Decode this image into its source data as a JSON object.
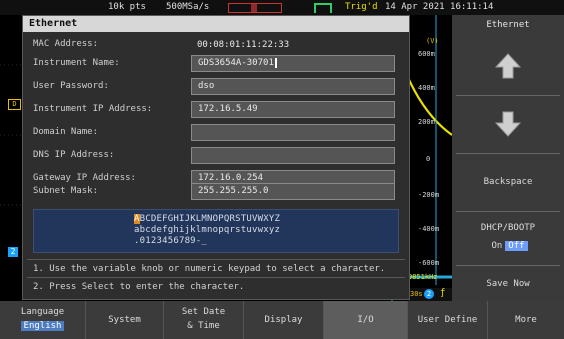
{
  "topbar": {
    "points": "10k pts",
    "sample_rate": "500MSa/s",
    "trigger_state": "Trig'd",
    "date_time": "14 Apr 2021 16:11:14"
  },
  "scale": {
    "unit": "(V)",
    "ticks": [
      "600m",
      "400m",
      "200m",
      "0",
      "-200m",
      "-400m",
      "-600m"
    ],
    "freq": "9851kHz",
    "timebase_fragment": "30s"
  },
  "markers": {
    "ref_d": "D",
    "ch2": "2"
  },
  "dialog": {
    "title": "Ethernet",
    "fields": [
      {
        "label": "MAC Address:",
        "value": "00:08:01:11:22:33",
        "editable": false
      },
      {
        "label": "Instrument Name:",
        "value": "GDS3654A-30701",
        "editable": true
      },
      {
        "label": "User Password:",
        "value": "dso",
        "editable": true
      },
      {
        "label": "Instrument IP Address:",
        "value": "172.16.5.49",
        "editable": true
      },
      {
        "label": "Domain Name:",
        "value": "",
        "editable": true
      },
      {
        "label": "DNS IP Address:",
        "value": "",
        "editable": true
      },
      {
        "label": "Gateway IP Address:",
        "value": "172.16.0.254",
        "editable": true
      },
      {
        "label": "Subnet Mask:",
        "value": "255.255.255.0",
        "editable": true
      }
    ],
    "charset": {
      "highlight_char": "A",
      "line1_rest": "BCDEFGHIJKLMNOPQRSTUVWXYZ",
      "line2": "abcdefghijklmnopqrstuvwxyz",
      "line3": ".0123456789-_"
    },
    "instructions": [
      "1. Use the variable knob or numeric keypad to select a character.",
      "2. Press Select to enter the character."
    ]
  },
  "side_menu": {
    "title": "Ethernet",
    "backspace": "Backspace",
    "dhcp_label": "DHCP/BOOTP",
    "dhcp_on": "On",
    "dhcp_off": "Off",
    "save_now": "Save Now"
  },
  "bottom_menu": {
    "language_label": "Language",
    "language_value": "English",
    "system": "System",
    "set_date_1": "Set Date",
    "set_date_2": "& Time",
    "display": "Display",
    "io": "I/O",
    "user_define": "User Define",
    "more": "More"
  },
  "colors": {
    "trace": "#e8e000",
    "ch2_marker": "#1aa0ff",
    "trigger_green": "#33cc66",
    "highlight_orange": "#e08a1e",
    "active_off": "#6d9cff"
  },
  "icons": [
    "up-arrow-icon",
    "down-arrow-icon",
    "trigger-edge-icon",
    "waveform-zoom-icon",
    "ch2-icon",
    "rising-edge-icon"
  ]
}
